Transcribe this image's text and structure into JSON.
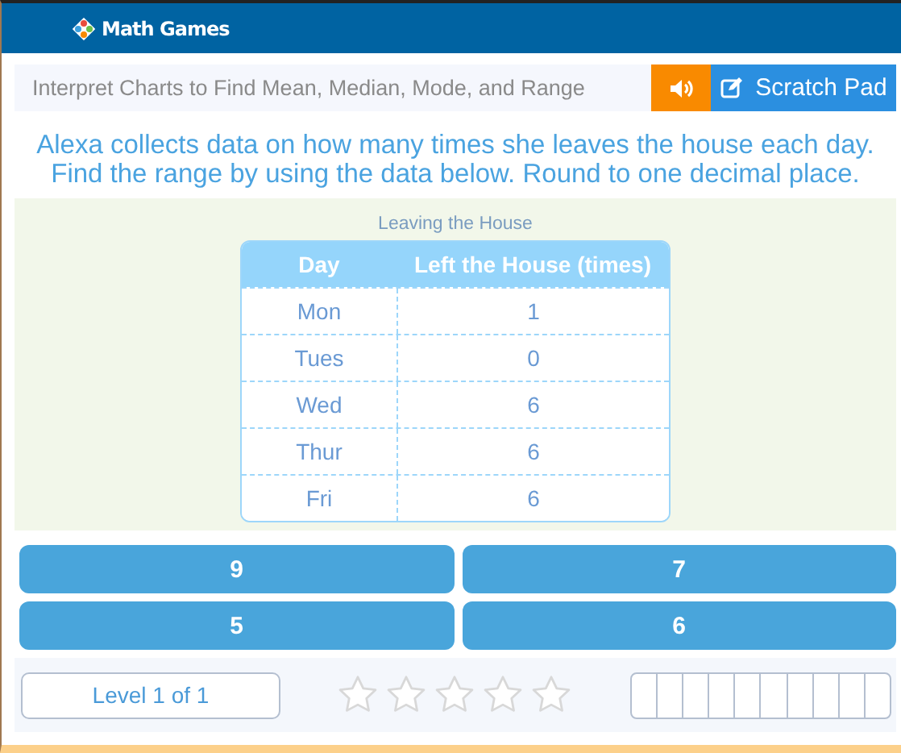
{
  "header": {
    "logo": "Math Games"
  },
  "title_bar": {
    "title": "Interpret Charts to Find Mean, Median, Mode, and Range",
    "scratch_pad": "Scratch Pad"
  },
  "question": "Alexa collects data on how many times she leaves the house each day. Find the range by using the data below. Round to one decimal place.",
  "table": {
    "caption": "Leaving the House",
    "columns": [
      "Day",
      "Left the House (times)"
    ],
    "rows": [
      [
        "Mon",
        "1"
      ],
      [
        "Tues",
        "0"
      ],
      [
        "Wed",
        "6"
      ],
      [
        "Thur",
        "6"
      ],
      [
        "Fri",
        "6"
      ]
    ]
  },
  "answers": [
    "9",
    "7",
    "5",
    "6"
  ],
  "footer": {
    "level": "Level 1 of 1",
    "stars": 0
  }
}
